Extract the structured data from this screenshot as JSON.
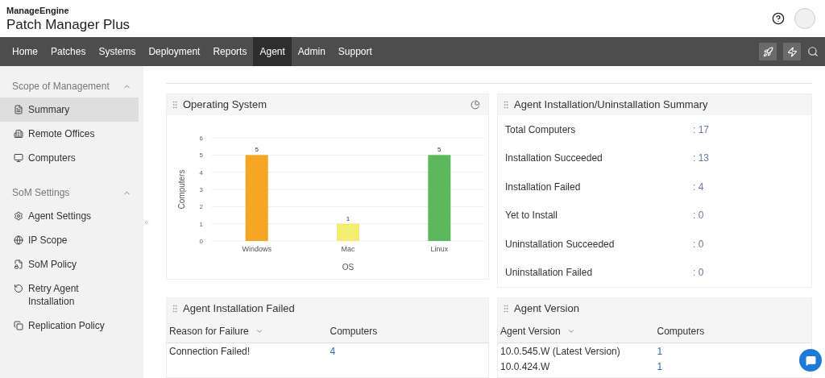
{
  "header": {
    "brand_top": "ManageEngine",
    "product": "Patch Manager Plus"
  },
  "nav": [
    {
      "label": "Home",
      "selected": false
    },
    {
      "label": "Patches",
      "selected": false
    },
    {
      "label": "Systems",
      "selected": false
    },
    {
      "label": "Deployment",
      "selected": false
    },
    {
      "label": "Reports",
      "selected": false
    },
    {
      "label": "Agent",
      "selected": true
    },
    {
      "label": "Admin",
      "selected": false
    },
    {
      "label": "Support",
      "selected": false
    }
  ],
  "sidebar": [
    {
      "title": "Scope of Management",
      "expanded": true,
      "items": [
        {
          "label": "Summary",
          "selected": true
        },
        {
          "label": "Remote Offices",
          "selected": false
        },
        {
          "label": "Computers",
          "selected": false
        }
      ]
    },
    {
      "title": "SoM Settings",
      "expanded": true,
      "items": [
        {
          "label": "Agent Settings",
          "selected": false
        },
        {
          "label": "IP Scope",
          "selected": false
        },
        {
          "label": "SoM Policy",
          "selected": false
        },
        {
          "label": "Retry Agent Installation",
          "selected": false
        },
        {
          "label": "Replication Policy",
          "selected": false
        }
      ]
    }
  ],
  "os_card": {
    "title": "Operating System",
    "chart_data": {
      "type": "bar",
      "xlabel": "OS",
      "ylabel": "Computers",
      "series": [
        {
          "name": "Windows",
          "color": "#f5a623",
          "values": [
            5,
            null,
            null
          ]
        },
        {
          "name": "Mac",
          "color": "#f3ee71",
          "values": [
            null,
            1,
            null
          ]
        },
        {
          "name": "Linux",
          "color": "#5cb85c",
          "values": [
            null,
            null,
            5
          ]
        }
      ],
      "stacked": true,
      "grid": true,
      "ylim": [
        0,
        6
      ],
      "yticks": [
        0,
        1,
        2,
        3,
        4,
        5,
        6
      ],
      "data_labels": true
    }
  },
  "summary_card": {
    "title": "Agent Installation/Uninstallation Summary",
    "separator": ":",
    "rows": [
      {
        "label": "Total Computers",
        "value": "17"
      },
      {
        "label": "Installation Succeeded",
        "value": "13"
      },
      {
        "label": "Installation Failed",
        "value": "4"
      },
      {
        "label": "Yet to Install",
        "value": "0"
      },
      {
        "label": "Uninstallation Succeeded",
        "value": "0"
      },
      {
        "label": "Uninstallation Failed",
        "value": "0"
      }
    ]
  },
  "failed_card": {
    "title": "Agent Installation Failed",
    "columns": [
      {
        "label": "Reason for Failure",
        "sorted": true
      },
      {
        "label": "Computers",
        "sorted": false
      }
    ],
    "rows": [
      [
        "Connection Failed!",
        "4"
      ]
    ]
  },
  "version_card": {
    "title": "Agent Version",
    "columns": [
      {
        "label": "Agent Version",
        "sorted": true
      },
      {
        "label": "Computers",
        "sorted": false
      }
    ],
    "rows": [
      [
        "10.0.545.W (Latest Version)",
        "1"
      ],
      [
        "10.0.424.W",
        "1"
      ]
    ]
  }
}
